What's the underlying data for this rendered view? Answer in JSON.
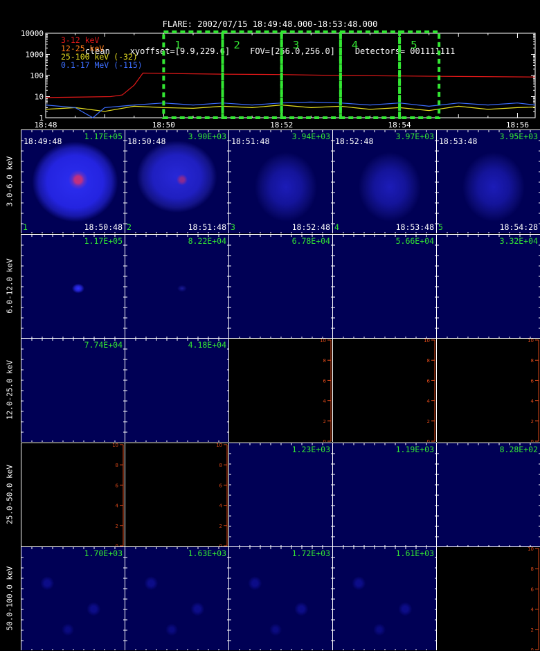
{
  "header": {
    "line1": "FLARE: 2002/07/15 18:49:48.000-18:53:48.000",
    "line2": "clean    xyoffset=[9.9,229.6]    FOV=[256.0,256.0]    Detectors= 001111111"
  },
  "chart_data": {
    "type": "line",
    "title": "",
    "xlabel": "",
    "ylabel": "",
    "y_scale": "log",
    "ylim": [
      1,
      10000
    ],
    "y_ticks": [
      "10000",
      "1000",
      "100",
      "10",
      "1"
    ],
    "x_ticks": [
      "18:48",
      "18:50",
      "18:52",
      "18:54",
      "18:56"
    ],
    "x_range_minutes": [
      0,
      8.3
    ],
    "legend_position": "top-left",
    "series": [
      {
        "name": "3-12 keV",
        "color": "#e01818",
        "points": [
          [
            0,
            9
          ],
          [
            1.1,
            10
          ],
          [
            1.3,
            12
          ],
          [
            1.5,
            35
          ],
          [
            1.65,
            130
          ],
          [
            2,
            125
          ],
          [
            3,
            115
          ],
          [
            4,
            110
          ],
          [
            5,
            100
          ],
          [
            6,
            95
          ],
          [
            7,
            90
          ],
          [
            8.3,
            85
          ]
        ]
      },
      {
        "name": "12-25 keV",
        "color": "#ff7d1a",
        "points": []
      },
      {
        "name": "25-100 keV (-32)",
        "color": "#e8e020",
        "points": [
          [
            0,
            2.5
          ],
          [
            0.5,
            3
          ],
          [
            1,
            2
          ],
          [
            1.5,
            3.5
          ],
          [
            2,
            3
          ],
          [
            2.5,
            2.8
          ],
          [
            3,
            3.5
          ],
          [
            3.5,
            3
          ],
          [
            4,
            4
          ],
          [
            4.5,
            3
          ],
          [
            5,
            3.5
          ],
          [
            5.5,
            2.5
          ],
          [
            6,
            3
          ],
          [
            6.5,
            2.2
          ],
          [
            7,
            3.5
          ],
          [
            7.5,
            2.5
          ],
          [
            8,
            3
          ],
          [
            8.3,
            3.2
          ]
        ]
      },
      {
        "name": "0.1-17 MeV (-115)",
        "color": "#3c6eff",
        "points": [
          [
            0,
            4
          ],
          [
            0.5,
            3
          ],
          [
            0.8,
            1
          ],
          [
            1,
            3
          ],
          [
            1.5,
            4
          ],
          [
            2,
            5
          ],
          [
            2.5,
            4
          ],
          [
            3,
            5
          ],
          [
            3.5,
            4
          ],
          [
            4,
            5
          ],
          [
            4.5,
            5.5
          ],
          [
            5,
            5
          ],
          [
            5.5,
            4
          ],
          [
            6,
            5
          ],
          [
            6.5,
            3.5
          ],
          [
            7,
            5
          ],
          [
            7.5,
            4
          ],
          [
            8,
            5
          ],
          [
            8.3,
            4
          ]
        ]
      }
    ],
    "intervals": [
      {
        "label": "1",
        "start": 2.0,
        "end": 3.0
      },
      {
        "label": "2",
        "start": 3.0,
        "end": 4.0
      },
      {
        "label": "3",
        "start": 4.0,
        "end": 5.0
      },
      {
        "label": "4",
        "start": 5.0,
        "end": 6.0
      },
      {
        "label": "5",
        "start": 6.0,
        "end": 6.67
      }
    ]
  },
  "energy_bands": [
    "3.0-6.0 keV",
    "6.0-12.0 keV",
    "12.0-25.0 keV",
    "25.0-50.0 keV",
    "50.0-100.0 keV"
  ],
  "columns": [
    {
      "number": "1",
      "start": "18:49:48",
      "end": "18:50:48"
    },
    {
      "number": "2",
      "start": "18:50:48",
      "end": "18:51:48"
    },
    {
      "number": "3",
      "start": "18:51:48",
      "end": "18:52:48"
    },
    {
      "number": "4",
      "start": "18:52:48",
      "end": "18:53:48"
    },
    {
      "number": "5",
      "start": "18:53:48",
      "end": "18:54:28"
    }
  ],
  "images": [
    [
      {
        "peak": "1.17E+05",
        "kind": "flare-bright"
      },
      {
        "peak": "3.90E+03",
        "kind": "flare-mid"
      },
      {
        "peak": "3.94E+03",
        "kind": "flare-dim"
      },
      {
        "peak": "3.97E+03",
        "kind": "flare-dim"
      },
      {
        "peak": "3.95E+03",
        "kind": "flare-dim"
      }
    ],
    [
      {
        "peak": "1.17E+05",
        "kind": "dot"
      },
      {
        "peak": "8.22E+04",
        "kind": "dot-faint"
      },
      {
        "peak": "6.78E+04",
        "kind": "plain"
      },
      {
        "peak": "5.66E+04",
        "kind": "plain"
      },
      {
        "peak": "3.32E+04",
        "kind": "plain"
      }
    ],
    [
      {
        "peak": "7.74E+04",
        "kind": "plain"
      },
      {
        "peak": "4.18E+04",
        "kind": "plain"
      },
      {
        "peak": "",
        "kind": "empty"
      },
      {
        "peak": "",
        "kind": "empty"
      },
      {
        "peak": "",
        "kind": "empty"
      }
    ],
    [
      {
        "peak": "",
        "kind": "empty"
      },
      {
        "peak": "",
        "kind": "empty"
      },
      {
        "peak": "1.23E+03",
        "kind": "plain"
      },
      {
        "peak": "1.19E+03",
        "kind": "plain"
      },
      {
        "peak": "8.28E+02",
        "kind": "plain"
      }
    ],
    [
      {
        "peak": "1.70E+03",
        "kind": "noise"
      },
      {
        "peak": "1.63E+03",
        "kind": "noise"
      },
      {
        "peak": "1.72E+03",
        "kind": "noise"
      },
      {
        "peak": "1.61E+03",
        "kind": "noise"
      },
      {
        "peak": "",
        "kind": "empty"
      }
    ]
  ],
  "empty_axis_ticks": [
    "0",
    "2",
    "4",
    "6",
    "8",
    "10"
  ],
  "colors": {
    "image_bg": "#000055",
    "highlight_green": "#33e633",
    "empty_axis": "#e04a1a"
  }
}
